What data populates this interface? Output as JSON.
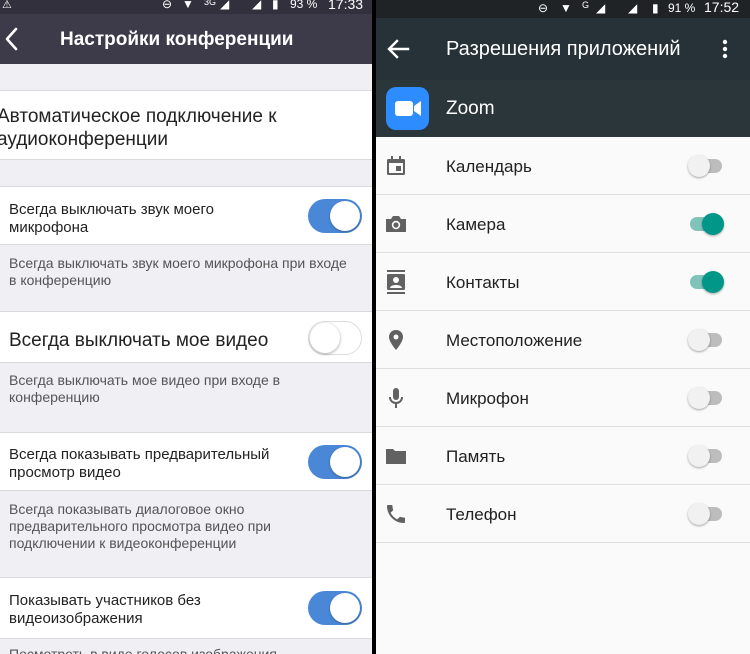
{
  "left": {
    "status": {
      "battery": "93 %",
      "time": "17:33",
      "network": "3G"
    },
    "header": {
      "title": "Настройки конференции"
    },
    "auto_connect": {
      "label": "Автоматическое подключение к аудиоконференции"
    },
    "settings": [
      {
        "label": "Всегда выключать звук моего микрофона",
        "description": "Всегда выключать звук моего микрофона при входе в конференцию",
        "enabled": true
      },
      {
        "label": "Всегда выключать мое видео",
        "description": "Всегда выключать мое видео при входе в конференцию",
        "enabled": false
      },
      {
        "label": "Всегда показывать предварительный просмотр видео",
        "description": "Всегда показывать диалоговое окно предварительного просмотра видео при подключении к видеоконференции",
        "enabled": true
      },
      {
        "label": "Показывать участников без видеоизображения",
        "description": "Посмотреть в виде голосов изображения",
        "enabled": true
      }
    ],
    "colors": {
      "header": "#3d3a4a",
      "toggle_on": "#4a87d6"
    }
  },
  "right": {
    "status": {
      "battery": "91 %",
      "time": "17:52",
      "network": "G"
    },
    "header": {
      "title": "Разрешения приложений"
    },
    "app": {
      "name": "Zoom",
      "icon": "zoom-video-icon"
    },
    "permissions": [
      {
        "label": "Календарь",
        "icon": "calendar-icon",
        "enabled": false
      },
      {
        "label": "Камера",
        "icon": "camera-icon",
        "enabled": true
      },
      {
        "label": "Контакты",
        "icon": "contacts-icon",
        "enabled": true
      },
      {
        "label": "Местоположение",
        "icon": "location-icon",
        "enabled": false
      },
      {
        "label": "Микрофон",
        "icon": "microphone-icon",
        "enabled": false
      },
      {
        "label": "Память",
        "icon": "folder-icon",
        "enabled": false
      },
      {
        "label": "Телефон",
        "icon": "phone-icon",
        "enabled": false
      }
    ],
    "colors": {
      "header": "#263238",
      "switch_on": "#009688",
      "zoom_blue": "#2d8cff"
    }
  }
}
